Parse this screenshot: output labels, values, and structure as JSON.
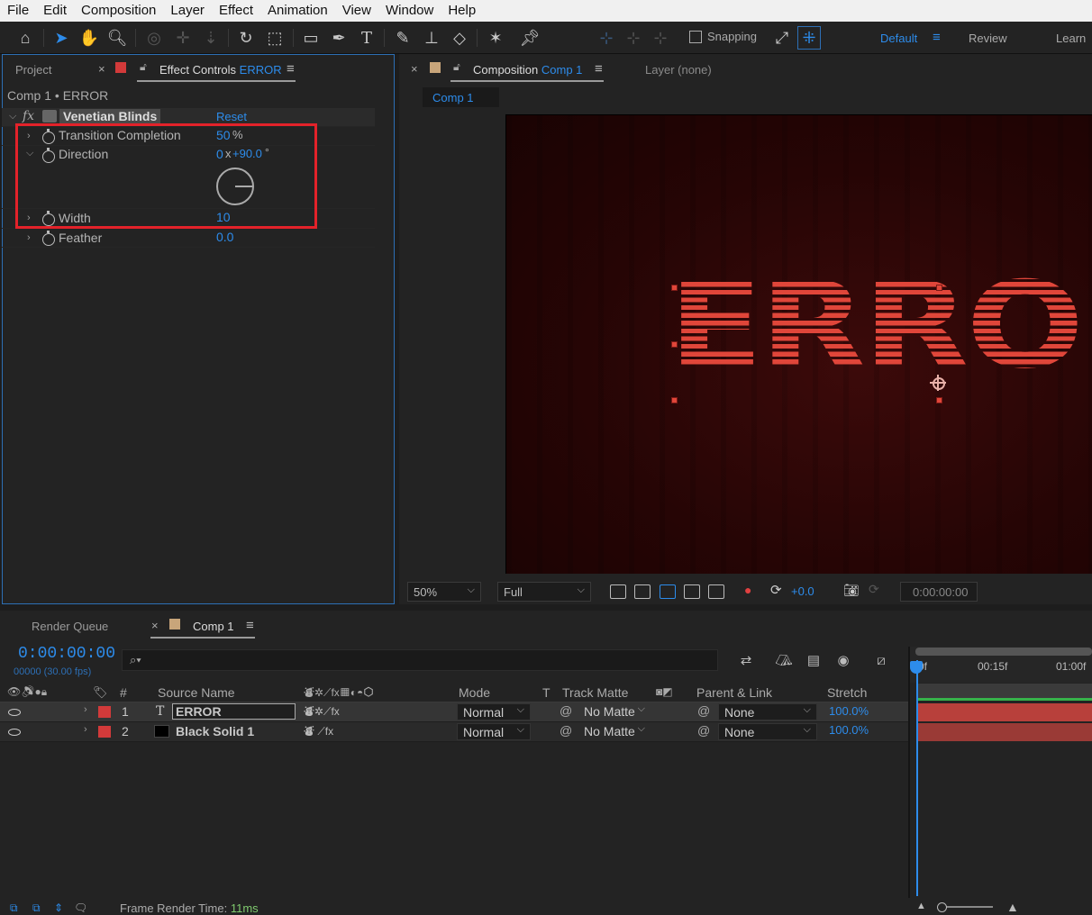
{
  "menu": [
    "File",
    "Edit",
    "Composition",
    "Layer",
    "Effect",
    "Animation",
    "View",
    "Window",
    "Help"
  ],
  "toolbar": {
    "snapping_label": "Snapping",
    "workspaces": {
      "active": "Default",
      "review": "Review",
      "learn": "Learn"
    }
  },
  "left_panel": {
    "tab_project": "Project",
    "tab_effect_controls": "Effect Controls",
    "tab_effect_layer": "ERROR",
    "header": "Comp 1 • ERROR",
    "effect": {
      "fx": "fx",
      "name": "Venetian Blinds",
      "reset": "Reset",
      "properties": [
        {
          "name": "Transition Completion",
          "value": "50",
          "unit": "%"
        },
        {
          "name": "Direction",
          "value": "0",
          "unit": "x",
          "value2": "+90.0",
          "unit2": "°"
        },
        {
          "name": "Width",
          "value": "10"
        },
        {
          "name": "Feather",
          "value": "0.0"
        }
      ]
    }
  },
  "comp_panel": {
    "tab_label": "Composition",
    "tab_comp_name": "Comp 1",
    "tab_layer": "Layer (none)",
    "subtab": "Comp 1",
    "canvas_text": "ERRO",
    "zoom": "50%",
    "resolution": "Full",
    "exposure": "+0.0",
    "timecode": "0:00:00:00"
  },
  "timeline": {
    "tab_render_queue": "Render Queue",
    "tab_comp": "Comp 1",
    "timecode": "0:00:00:00",
    "frames_fps": "00000 (30.00 fps)",
    "search_placeholder": "",
    "columns": {
      "num": "#",
      "source_name": "Source Name",
      "mode": "Mode",
      "t": "T",
      "track_matte": "Track Matte",
      "parent": "Parent & Link",
      "stretch": "Stretch"
    },
    "layers": [
      {
        "num": "1",
        "type_icon": "T",
        "name": "ERROR",
        "mode": "Normal",
        "matte": "No Matte",
        "parent": "None",
        "stretch": "100.0%"
      },
      {
        "num": "2",
        "type_icon": "",
        "name": "Black Solid 1",
        "mode": "Normal",
        "matte": "No Matte",
        "parent": "None",
        "stretch": "100.0%"
      }
    ],
    "ruler": [
      "0f",
      "00:15f",
      "01:00f"
    ]
  },
  "status": {
    "frame_render_label": "Frame Render Time:",
    "frame_render_value": "11ms"
  },
  "colors": {
    "accent": "#2d8ceb",
    "highlight_box": "#e3222a",
    "layer_label": "#d23a3a",
    "comp_label": "#c8a57a"
  }
}
